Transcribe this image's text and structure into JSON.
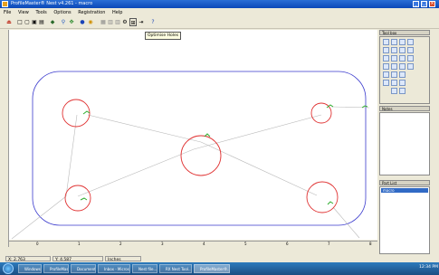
{
  "window": {
    "title": "ProfileMaster® Nest v4.261 - macro"
  },
  "menu": [
    "File",
    "View",
    "Tools",
    "Options",
    "Registration",
    "Help"
  ],
  "tooltip": "Optimise Holes",
  "toolbox": {
    "title": "Tool box"
  },
  "notes": {
    "title": "Notes"
  },
  "part_list": {
    "title": "Part List",
    "items": [
      "macro"
    ]
  },
  "ruler_bottom": [
    "0",
    "1",
    "2",
    "3",
    "4",
    "5",
    "6",
    "7",
    "8"
  ],
  "status": {
    "x": "X: 2.763",
    "y": "Y: 4.587",
    "units": "Inches"
  },
  "taskbar": {
    "items": [
      "Windows...",
      "ProfileMaster",
      "Documents",
      "Inbox - Micros...",
      "Nest file...",
      "RX Nest Tool...",
      "ProfileMaster®..."
    ],
    "clock": "12:34 PM"
  },
  "colors": {
    "part_outline": "#3a3acd",
    "holes": "#e03232",
    "markers": "#2fae2f",
    "path": "#b9b9b9"
  }
}
